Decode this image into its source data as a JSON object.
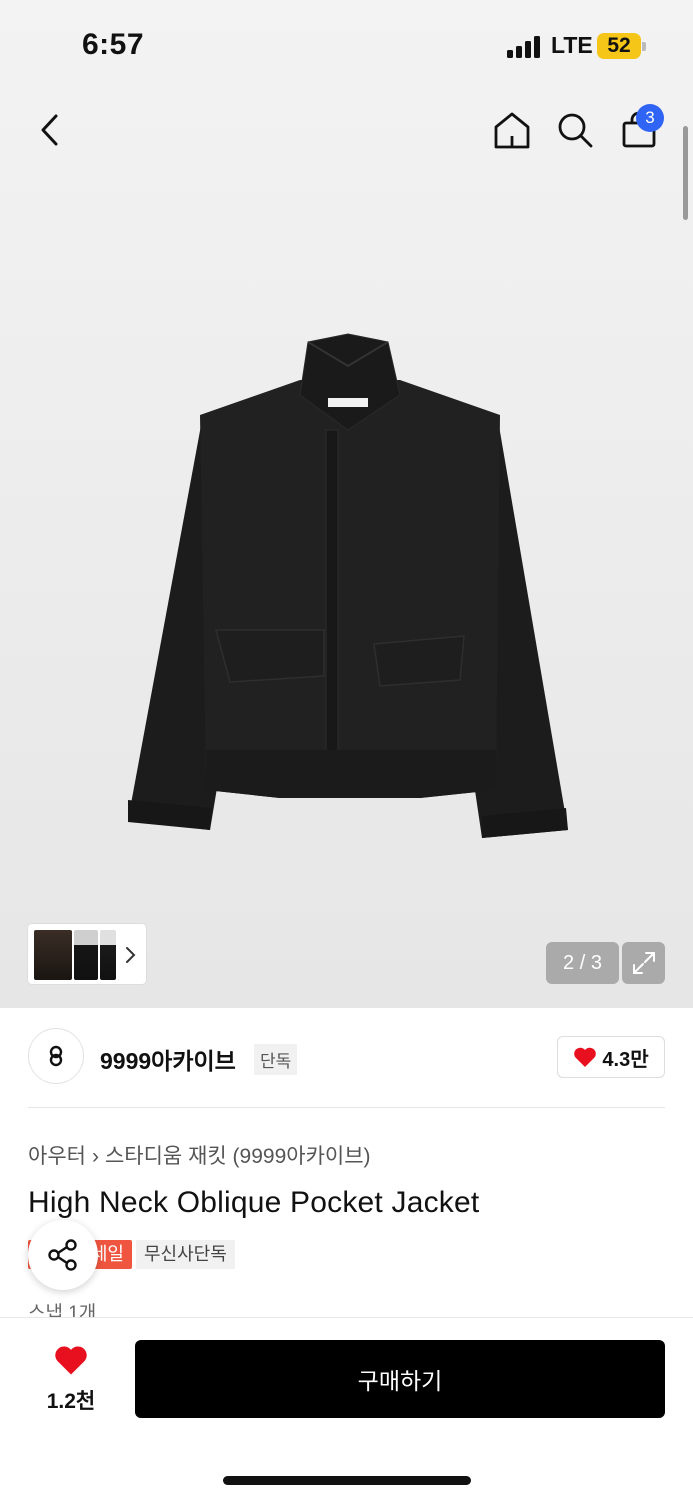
{
  "status": {
    "time": "6:57",
    "network": "LTE",
    "battery": "52"
  },
  "nav": {
    "cart_count": "3"
  },
  "gallery": {
    "pager": "2 / 3"
  },
  "brand": {
    "name": "9999아카이브",
    "tag": "단독",
    "likes": "4.3만"
  },
  "product": {
    "breadcrumb": [
      "아우터",
      "스타디움 재킷 (9999아카이브)"
    ],
    "title": "High Neck Oblique Pocket Jacket",
    "sale_badge": "세일",
    "exclusive_badge": "무신사단독",
    "snap_text": "스냅 1개"
  },
  "bottom": {
    "wish_count": "1.2천",
    "buy_label": "구매하기"
  },
  "colors": {
    "accent_blue": "#2f64f5",
    "sale_red": "#f0553f",
    "heart_red": "#e8101f",
    "battery_yellow": "#f5c518"
  }
}
